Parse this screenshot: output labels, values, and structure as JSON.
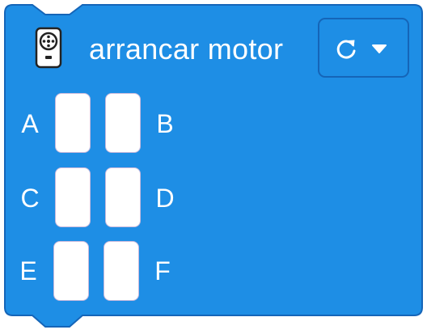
{
  "block": {
    "title": "arrancar motor",
    "fill_color": "#1e8ee5",
    "border_color": "#1565b8",
    "icon": "motor-icon",
    "direction_dropdown": {
      "icon": "rotate-clockwise-icon",
      "caret_icon": "caret-down-icon"
    },
    "ports": [
      {
        "label": "A"
      },
      {
        "label": "B"
      },
      {
        "label": "C"
      },
      {
        "label": "D"
      },
      {
        "label": "E"
      },
      {
        "label": "F"
      }
    ]
  }
}
